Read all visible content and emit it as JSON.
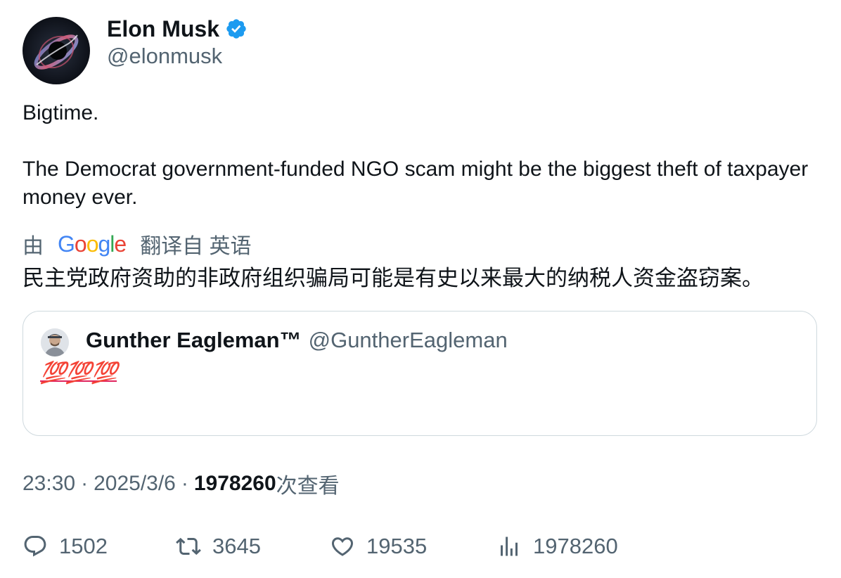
{
  "author": {
    "display_name": "Elon Musk",
    "handle": "@elonmusk",
    "verified_icon": "verified-badge-icon",
    "accent": "#1d9bf0"
  },
  "tweet": {
    "line1": "Bigtime.",
    "line2": "The Democrat government-funded NGO scam might be the biggest theft of taxpayer money ever."
  },
  "translation": {
    "prefix": "由",
    "google_letters": [
      "G",
      "o",
      "o",
      "g",
      "l",
      "e"
    ],
    "suffix": "翻译自 英语",
    "text": "民主党政府资助的非政府组织骗局可能是有史以来最大的纳税人资金盗窃案。"
  },
  "quote": {
    "display_name": "Gunther Eagleman™",
    "handle": "@GuntherEagleman",
    "text": "💯💯💯"
  },
  "meta": {
    "time": "23:30",
    "separator": "·",
    "date": "2025/3/6",
    "views_count": "1978260",
    "views_label": "次查看"
  },
  "actions": {
    "replies": "1502",
    "reposts": "3645",
    "likes": "19535",
    "views": "1978260"
  },
  "colors": {
    "text_primary": "#0f1419",
    "text_secondary": "#536471",
    "border": "#cfd9de",
    "google_blue": "#4285f4",
    "google_red": "#ea4335",
    "google_yellow": "#fbbc05",
    "google_green": "#34a853"
  }
}
